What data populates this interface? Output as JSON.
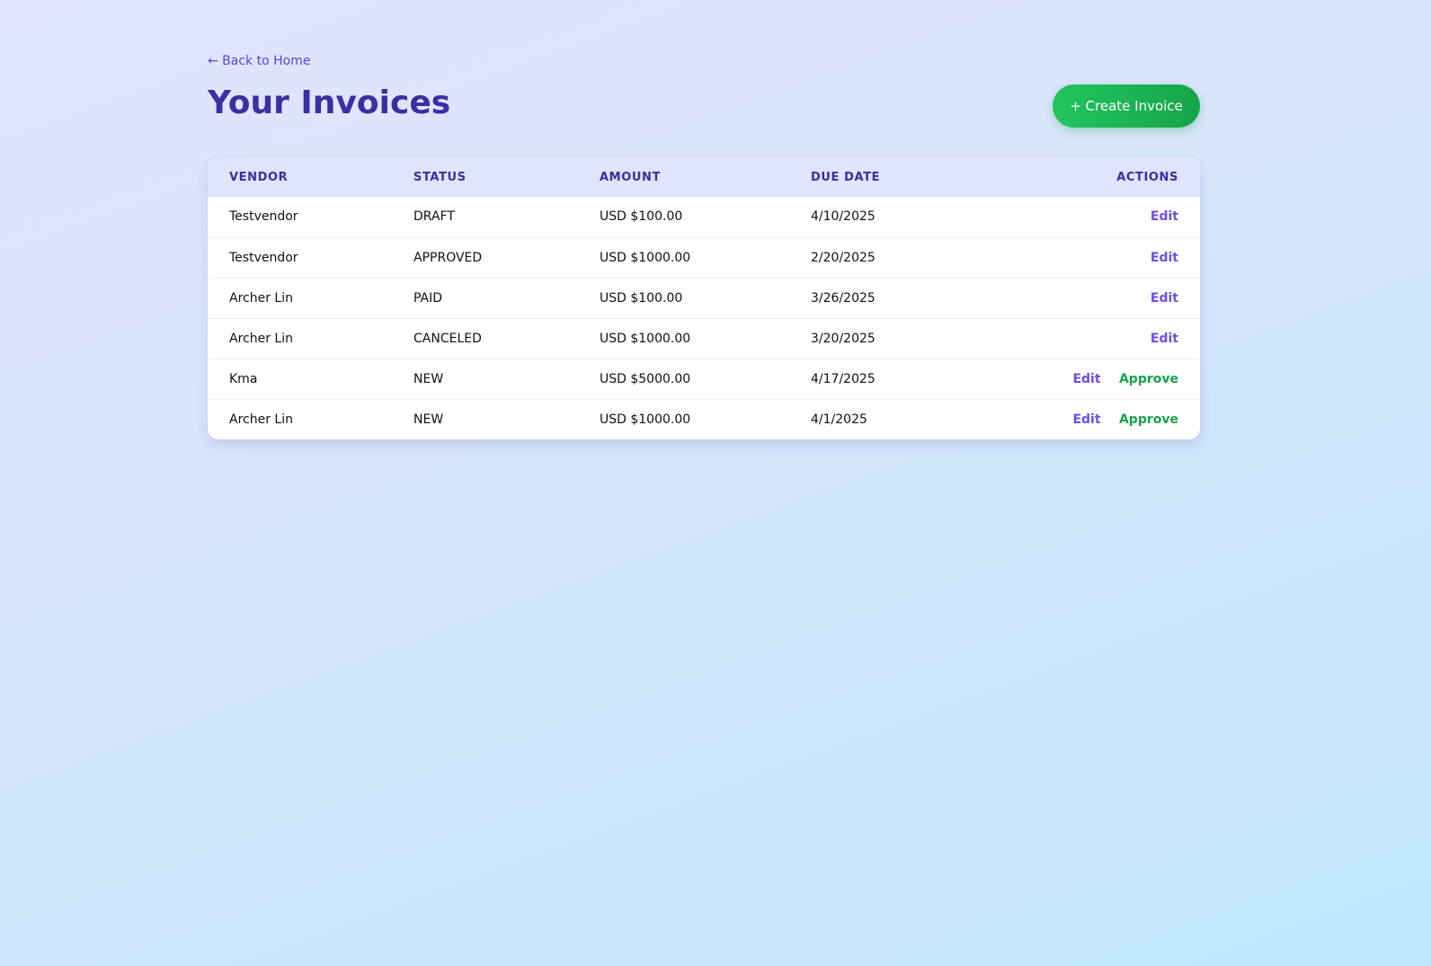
{
  "nav": {
    "back_label": "← Back to Home"
  },
  "header": {
    "title": "Your Invoices",
    "create_label": "+ Create Invoice"
  },
  "table": {
    "columns": [
      "VENDOR",
      "STATUS",
      "AMOUNT",
      "DUE DATE",
      "ACTIONS"
    ],
    "rows": [
      {
        "vendor": "Testvendor",
        "status": "DRAFT",
        "amount": "USD $100.00",
        "due_date": "4/10/2025",
        "actions": [
          "Edit"
        ]
      },
      {
        "vendor": "Testvendor",
        "status": "APPROVED",
        "amount": "USD $1000.00",
        "due_date": "2/20/2025",
        "actions": [
          "Edit"
        ]
      },
      {
        "vendor": "Archer Lin",
        "status": "PAID",
        "amount": "USD $100.00",
        "due_date": "3/26/2025",
        "actions": [
          "Edit"
        ]
      },
      {
        "vendor": "Archer Lin",
        "status": "CANCELED",
        "amount": "USD $1000.00",
        "due_date": "3/20/2025",
        "actions": [
          "Edit"
        ]
      },
      {
        "vendor": "Kma",
        "status": "NEW",
        "amount": "USD $5000.00",
        "due_date": "4/17/2025",
        "actions": [
          "Edit",
          "Approve"
        ]
      },
      {
        "vendor": "Archer Lin",
        "status": "NEW",
        "amount": "USD $1000.00",
        "due_date": "4/1/2025",
        "actions": [
          "Edit",
          "Approve"
        ]
      }
    ]
  },
  "colors": {
    "accent": "#3730a3",
    "link": "#4f46e5",
    "edit": "#6d4fe6",
    "approve": "#16a34a",
    "create_button": "#22c55e"
  }
}
